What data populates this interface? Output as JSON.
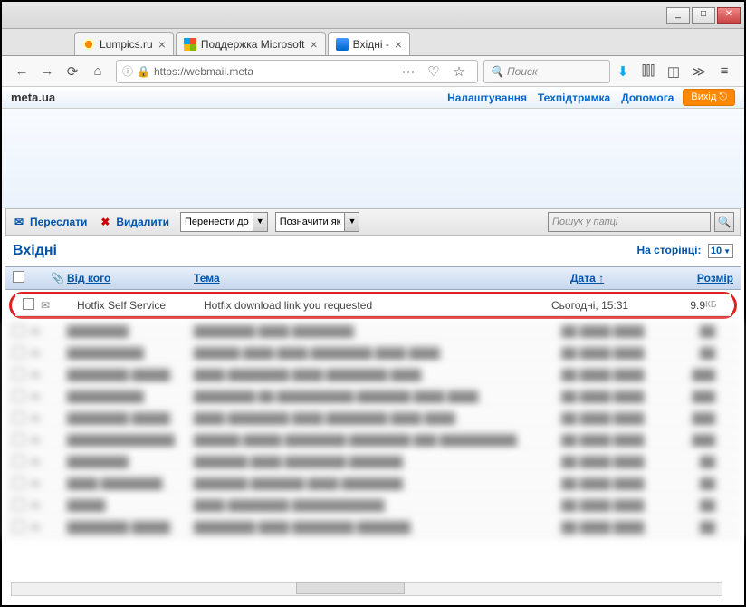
{
  "window": {
    "minimize": "_",
    "maximize": "□",
    "close": "✕"
  },
  "tabs": [
    {
      "label": "Lumpics.ru",
      "icon_color": "#f80"
    },
    {
      "label": "Поддержка Microsoft",
      "icon_color": "#0af"
    },
    {
      "label": "Вхідні -",
      "icon_color": "#05a",
      "active": true
    }
  ],
  "url": "https://webmail.meta",
  "search_placeholder": "Поиск",
  "brand": "meta.ua",
  "nav": {
    "settings": "Налаштування",
    "support": "Техпідтримка",
    "help": "Допомога",
    "exit": "Вихід"
  },
  "mail_toolbar": {
    "forward": "Переслати",
    "delete": "Видалити",
    "move_to": "Перенести до",
    "mark_as": "Позначити як",
    "search_placeholder": "Пошук у папці"
  },
  "folder": "Вхідні",
  "per_page_label": "На сторінці:",
  "per_page_value": "10",
  "columns": {
    "from": "Від кого",
    "subject": "Тема",
    "date": "Дата",
    "size": "Розмір"
  },
  "highlight_row": {
    "from": "Hotfix Self Service",
    "subject": "Hotfix download link you requested",
    "date": "Сьогодні, 15:31",
    "size": "9.9",
    "size_unit": "КБ"
  },
  "blur_rows": [
    {
      "from": "████████",
      "subject": "████████ ████ ████████",
      "date": "██ ████ ████",
      "size": "██"
    },
    {
      "from": "██████████",
      "subject": "██████ ████ ████ ████████ ████ ████",
      "date": "██ ████ ████",
      "size": "██"
    },
    {
      "from": "████████ █████",
      "subject": "████ ████████ ████ ████████ ████",
      "date": "██ ████ ████",
      "size": "███"
    },
    {
      "from": "██████████",
      "subject": "████████ ██ ██████████ ███████ ████ ████",
      "date": "██ ████ ████",
      "size": "███"
    },
    {
      "from": "████████ █████",
      "subject": "████ ████████ ████ ████████ ████ ████",
      "date": "██ ████ ████",
      "size": "███"
    },
    {
      "from": "██████████████",
      "subject": "██████ █████ ████████ ████████ ███ ██████████",
      "date": "██ ████ ████",
      "size": "███"
    },
    {
      "from": "████████",
      "subject": "███████ ████ ████████ ███████",
      "date": "██ ████ ████",
      "size": "██"
    },
    {
      "from": "████ ████████",
      "subject": "███████ ███████ ████ ████████",
      "date": "██ ████ ████",
      "size": "██"
    },
    {
      "from": "█████",
      "subject": "████ ████████ ████████████",
      "date": "██ ████ ████",
      "size": "██"
    },
    {
      "from": "████████ █████",
      "subject": "████████ ████ ████████ ███████",
      "date": "██ ████ ████",
      "size": "██"
    }
  ]
}
